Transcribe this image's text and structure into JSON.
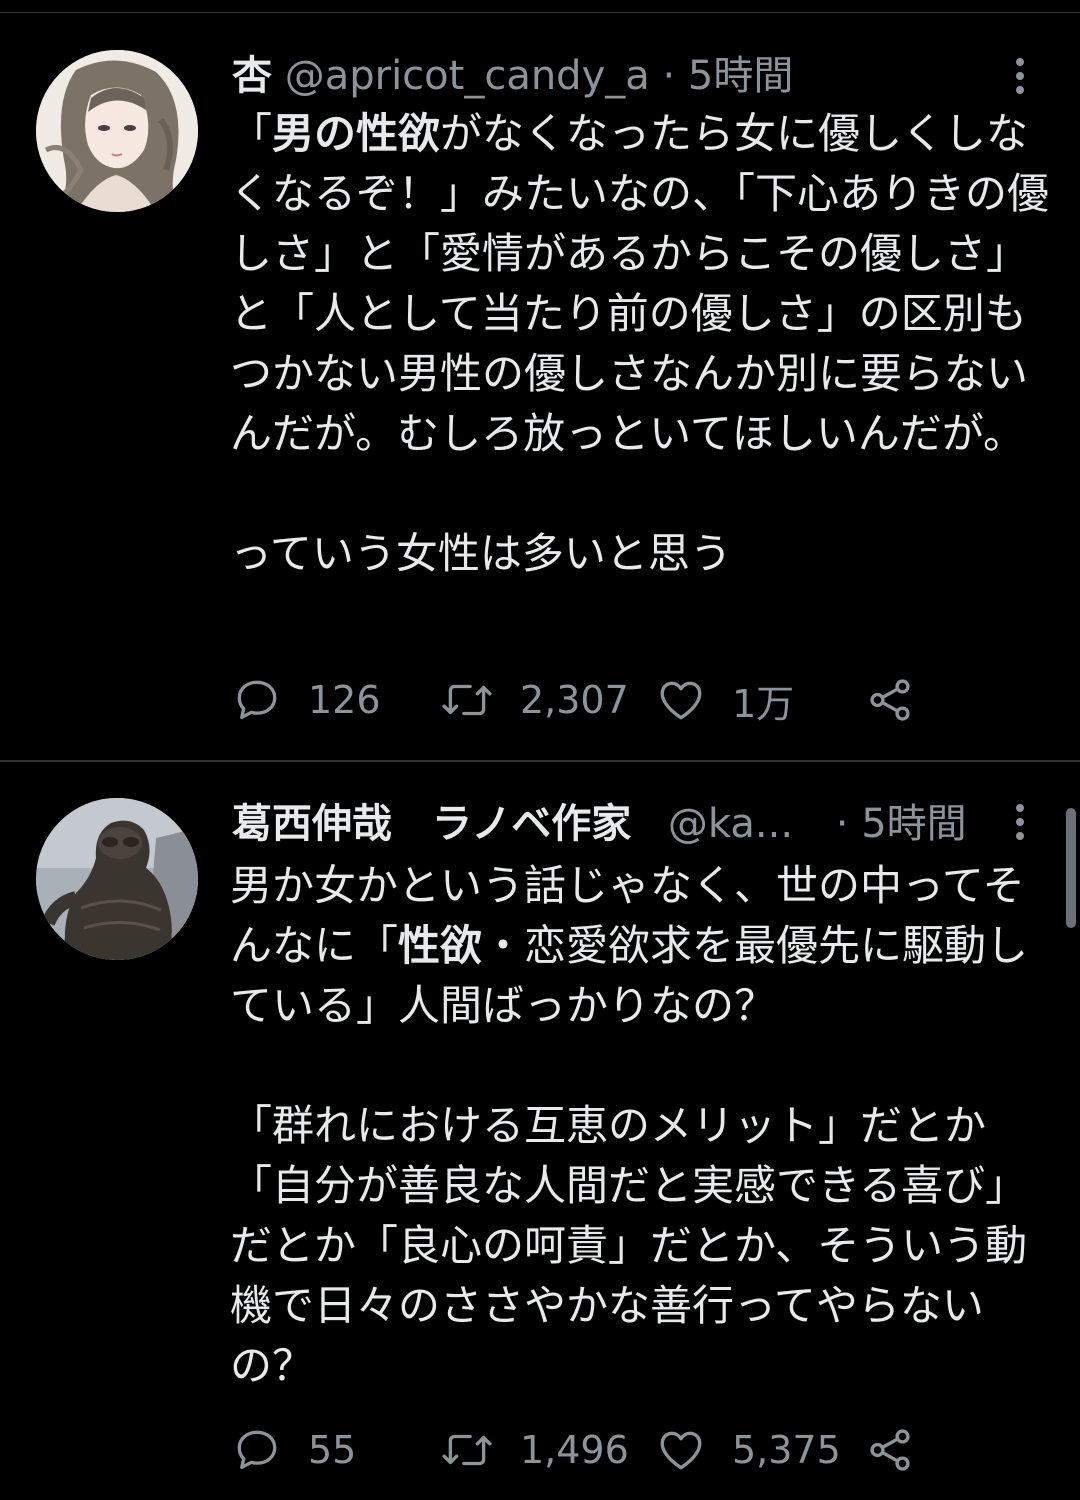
{
  "colors": {
    "background": "#000000",
    "primary_text": "#e7e9ea",
    "secondary_text": "#8b949b",
    "divider": "#2f3336"
  },
  "tweets": [
    {
      "display_name": "杏",
      "handle": "@apricot_candy_a",
      "separator": "·",
      "time": "5時間",
      "text_parts": [
        {
          "text": "「",
          "bold": false
        },
        {
          "text": "男の性欲",
          "bold": true
        },
        {
          "text": "がなくなったら女に優しくしなくなるぞ！」みたいなの、「下心ありきの優しさ」と「愛情があるからこその優しさ」と「人として当たり前の優しさ」の区別もつかない男性の優しさなんか別に要らないんだが。むしろ放っといてほしいんだが。\n\nっていう女性は多いと思う",
          "bold": false
        }
      ],
      "replies": "126",
      "retweets": "2,307",
      "likes": "1万",
      "icons": {
        "reply": "reply-icon",
        "retweet": "retweet-icon",
        "like": "heart-icon",
        "share": "share-icon",
        "more": "more-vertical-icon"
      }
    },
    {
      "display_name": "葛西伸哉　ラノベ作家",
      "handle": "@ka...",
      "separator": "·",
      "time": "5時間",
      "text_parts": [
        {
          "text": "男か女かという話じゃなく、世の中ってそんなに「",
          "bold": false
        },
        {
          "text": "性欲",
          "bold": true
        },
        {
          "text": "・恋愛欲求を最優先に駆動している」人間ばっかりなの？\n\n「群れにおける互恵のメリット」だとか「自分が善良な人間だと実感できる喜び」だとか「良心の呵責」だとか、そういう動機で日々のささやかな善行ってやらないの？",
          "bold": false
        }
      ],
      "replies": "55",
      "retweets": "1,496",
      "likes": "5,375",
      "icons": {
        "reply": "reply-icon",
        "retweet": "retweet-icon",
        "like": "heart-icon",
        "share": "share-icon",
        "more": "more-vertical-icon"
      }
    }
  ]
}
